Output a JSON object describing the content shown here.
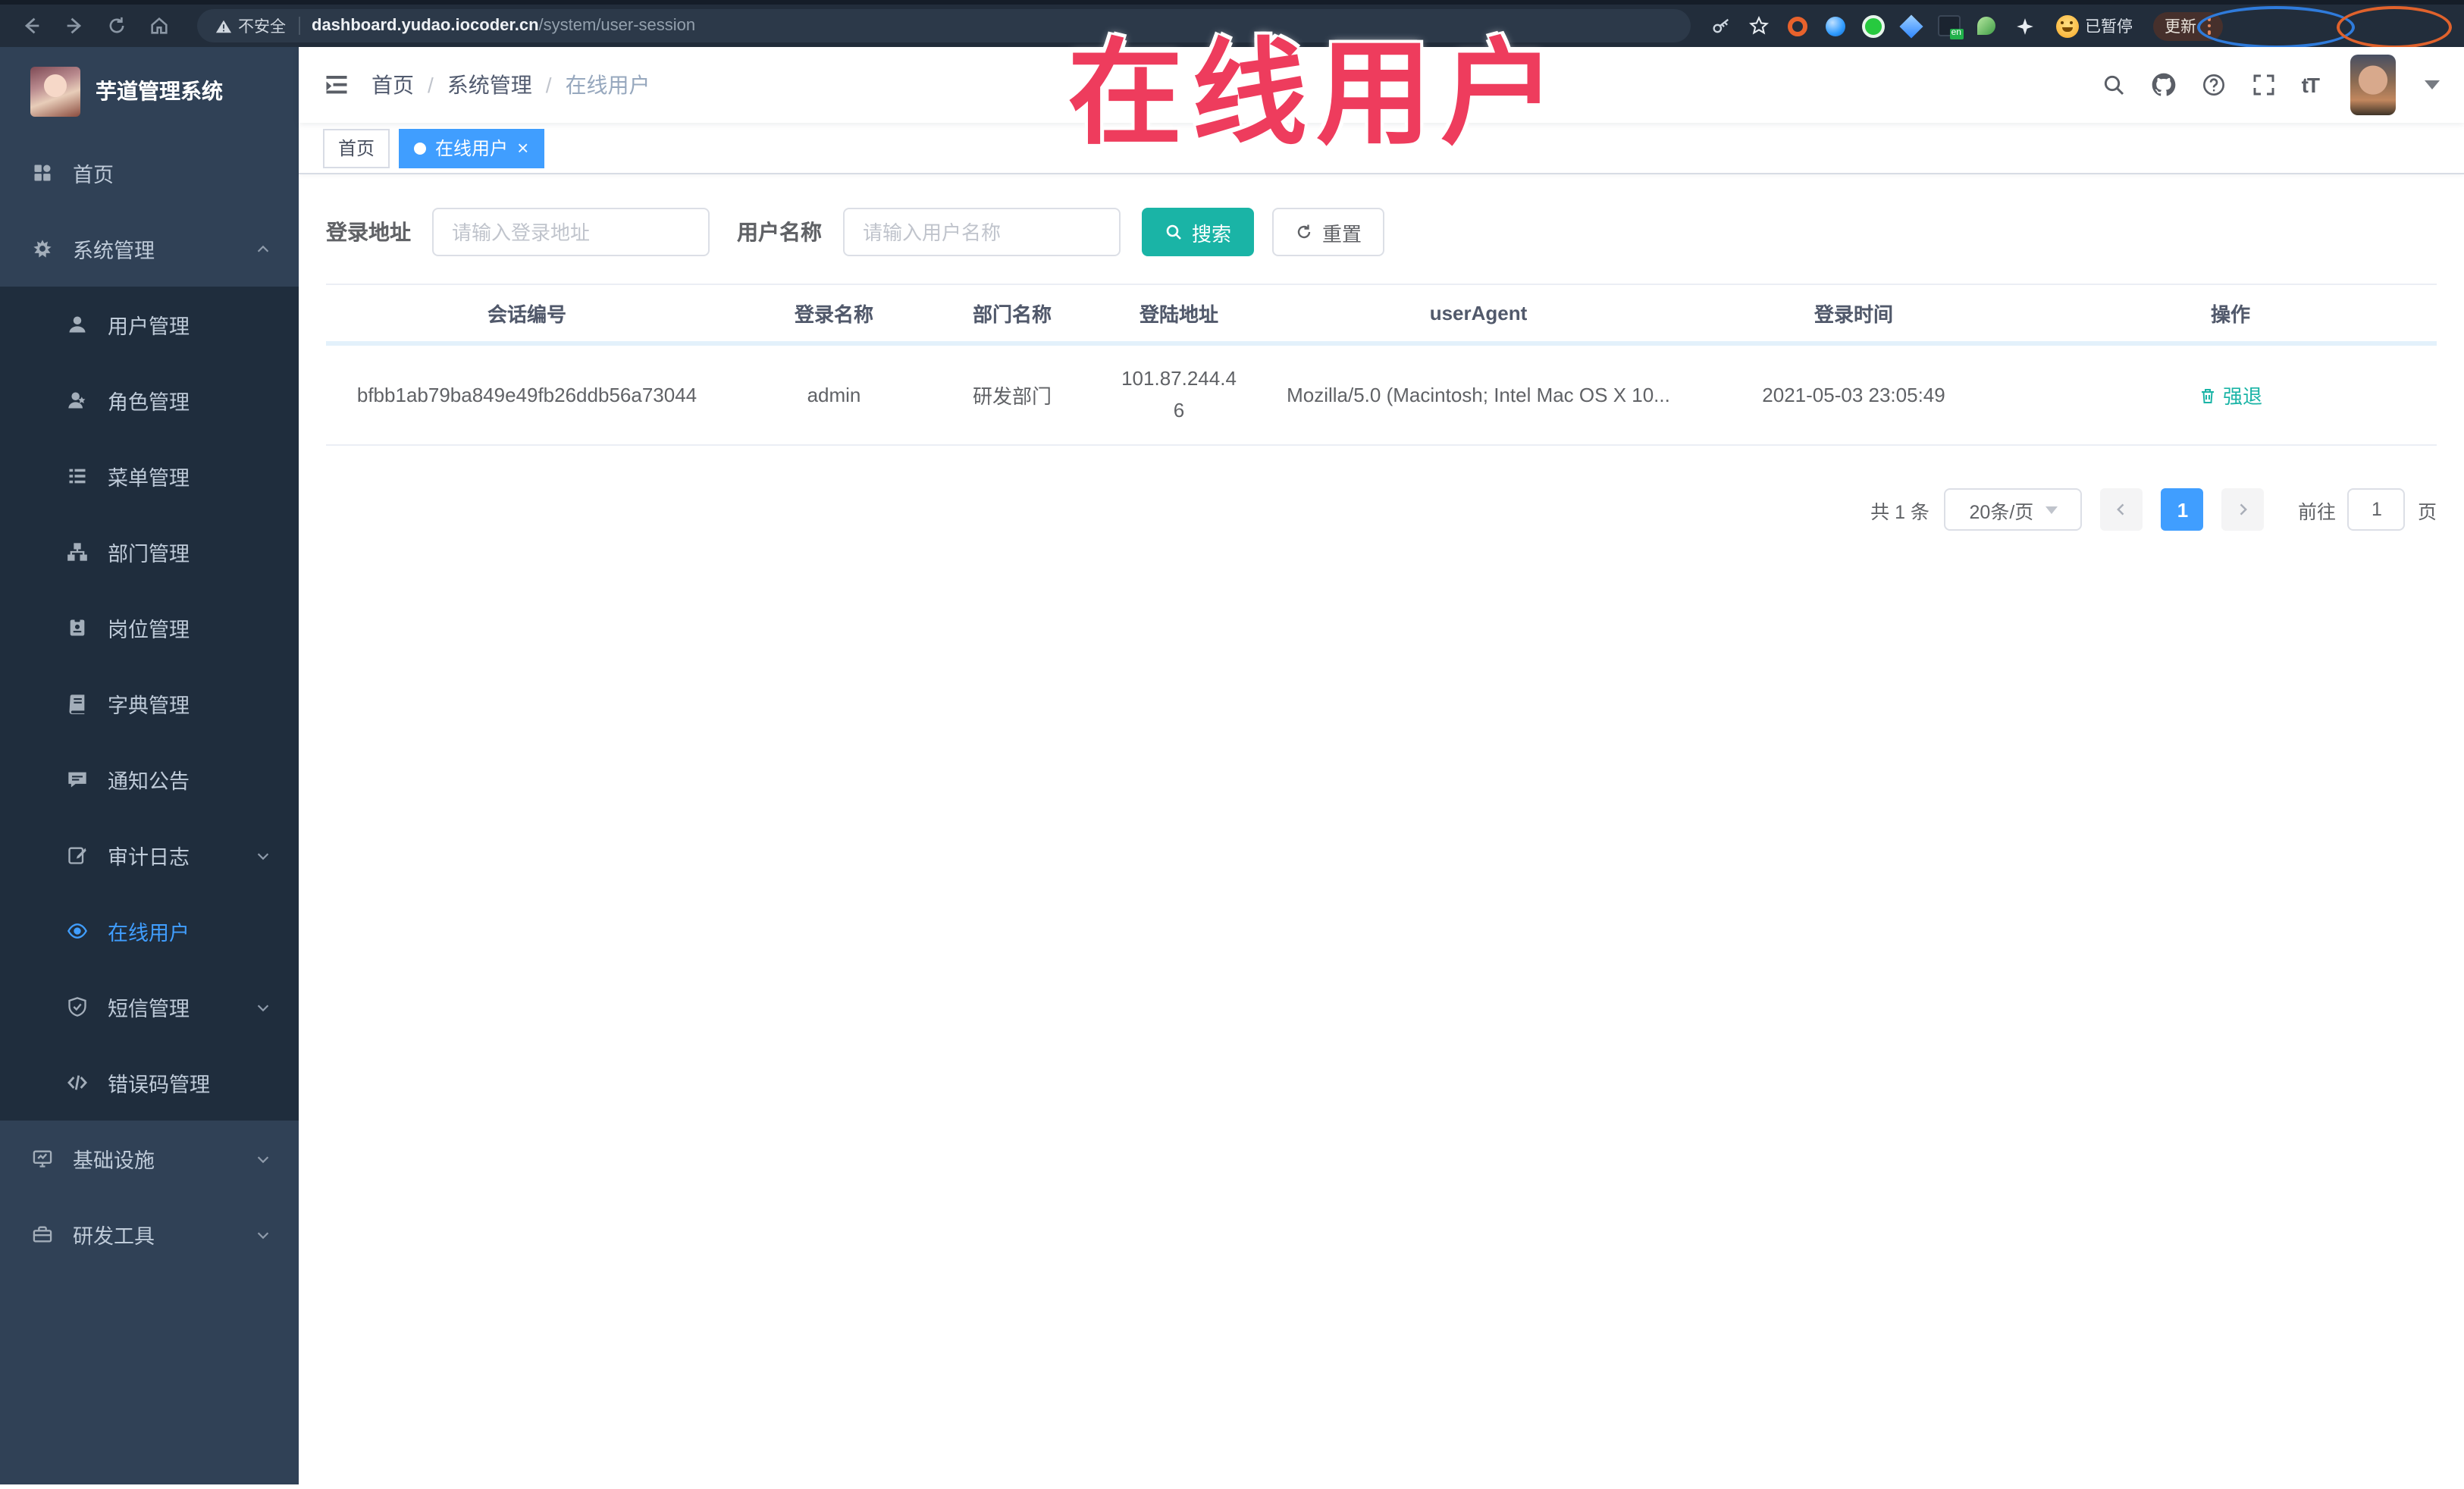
{
  "annotation": {
    "text": "在线用户"
  },
  "browser": {
    "security_label": "不安全",
    "url_host": "dashboard.yudao.iocoder.cn",
    "url_path": "/system/user-session",
    "extension_en_badge": "en",
    "paused_badge": "已暂停",
    "update_button": "更新"
  },
  "sidebar": {
    "app_title": "芋道管理系统",
    "items": [
      {
        "label": "首页"
      },
      {
        "label": "系统管理",
        "expanded": true
      },
      {
        "label": "用户管理"
      },
      {
        "label": "角色管理"
      },
      {
        "label": "菜单管理"
      },
      {
        "label": "部门管理"
      },
      {
        "label": "岗位管理"
      },
      {
        "label": "字典管理"
      },
      {
        "label": "通知公告"
      },
      {
        "label": "审计日志"
      },
      {
        "label": "在线用户",
        "active": true
      },
      {
        "label": "短信管理"
      },
      {
        "label": "错误码管理"
      },
      {
        "label": "基础设施"
      },
      {
        "label": "研发工具"
      }
    ]
  },
  "header": {
    "breadcrumb": [
      "首页",
      "系统管理",
      "在线用户"
    ],
    "font_size_icon_text": "tT"
  },
  "tags": {
    "home": "首页",
    "active_tab": "在线用户"
  },
  "filters": {
    "login_address_label": "登录地址",
    "login_address_placeholder": "请输入登录地址",
    "username_label": "用户名称",
    "username_placeholder": "请输入用户名称",
    "search_button": "搜索",
    "reset_button": "重置"
  },
  "table": {
    "columns": [
      "会话编号",
      "登录名称",
      "部门名称",
      "登陆地址",
      "userAgent",
      "登录时间",
      "操作"
    ],
    "rows": [
      {
        "session_id": "bfbb1ab79ba849e49fb26ddb56a73044",
        "login_name": "admin",
        "dept_name": "研发部门",
        "login_address": "101.87.244.46",
        "user_agent": "Mozilla/5.0 (Macintosh; Intel Mac OS X 10...",
        "login_time": "2021-05-03 23:05:49",
        "action": "强退"
      }
    ]
  },
  "pagination": {
    "total": "共 1 条",
    "page_size": "20条/页",
    "current_page": "1",
    "goto_label": "前往",
    "goto_value": "1",
    "page_unit": "页"
  },
  "colors": {
    "accent_blue": "#409eff",
    "theme_teal": "#1ab4a6",
    "sidebar_bg": "#304156",
    "submenu_bg": "#1f2d3d",
    "annotation_red": "#ee3c5d"
  }
}
